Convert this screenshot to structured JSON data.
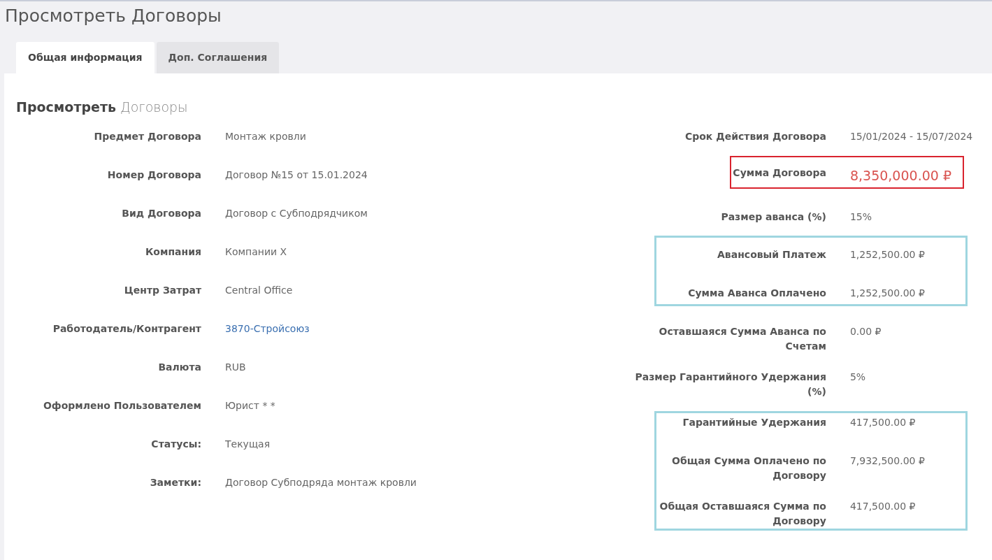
{
  "page_title": "Просмотреть Договоры",
  "tabs": [
    {
      "label": "Общая информация",
      "selected": true
    },
    {
      "label": "Доп. Соглашения",
      "selected": false
    }
  ],
  "panel": {
    "title_bold": "Просмотреть",
    "title_rest": "Договоры"
  },
  "left_fields": [
    {
      "label": "Предмет Договора",
      "value": "Монтаж кровли",
      "kind": "text"
    },
    {
      "label": "Номер Договора",
      "value": "Договор №15 от 15.01.2024",
      "kind": "text"
    },
    {
      "label": "Вид Договора",
      "value": "Договор с Субподрядчиком",
      "kind": "text"
    },
    {
      "label": "Компания",
      "value": "Компании X",
      "kind": "text"
    },
    {
      "label": "Центр Затрат",
      "value": "Central Office",
      "kind": "text"
    },
    {
      "label": "Работодатель/Контрагент",
      "value": "3870-Стройсоюз",
      "kind": "link"
    },
    {
      "label": "Валюта",
      "value": "RUB",
      "kind": "text"
    },
    {
      "label": "Оформлено Пользователем",
      "value": "Юрист * *",
      "kind": "text"
    },
    {
      "label": "Статусы:",
      "value": "Текущая",
      "kind": "text"
    },
    {
      "label": "Заметки:",
      "value": "Договор Субподряда монтаж кровли",
      "kind": "text"
    }
  ],
  "right_groups": [
    {
      "kind": "plain",
      "fields": [
        {
          "label": "Срок Действия Договора",
          "value": "15/01/2024 - 15/07/2024"
        }
      ]
    },
    {
      "kind": "total",
      "color": "#d9232e",
      "fields": [
        {
          "label": "Сумма Договора",
          "value": "8,350,000.00 ₽"
        }
      ]
    },
    {
      "kind": "plain",
      "fields": [
        {
          "label": "Размер аванса (%)",
          "value": "15%"
        }
      ]
    },
    {
      "kind": "group",
      "color": "#9fd6e0",
      "fields": [
        {
          "label": "Авансовый Платеж",
          "value": "1,252,500.00 ₽"
        },
        {
          "label": "Сумма Аванса Оплачено",
          "value": "1,252,500.00 ₽"
        }
      ]
    },
    {
      "kind": "plain",
      "fields": [
        {
          "label": "Оставшаяся Сумма Аванса по Счетам",
          "value": "0.00 ₽"
        },
        {
          "label": "Размер Гарантийного Удержания (%)",
          "value": "5%"
        }
      ]
    },
    {
      "kind": "group",
      "color": "#9fd6e0",
      "fields": [
        {
          "label": "Гарантийные Удержания",
          "value": "417,500.00 ₽"
        },
        {
          "label": "Общая Сумма Оплачено по Договору",
          "value": "7,932,500.00 ₽"
        },
        {
          "label": "Общая Оставшаяся Сумма по Договору",
          "value": "417,500.00 ₽"
        }
      ]
    }
  ]
}
